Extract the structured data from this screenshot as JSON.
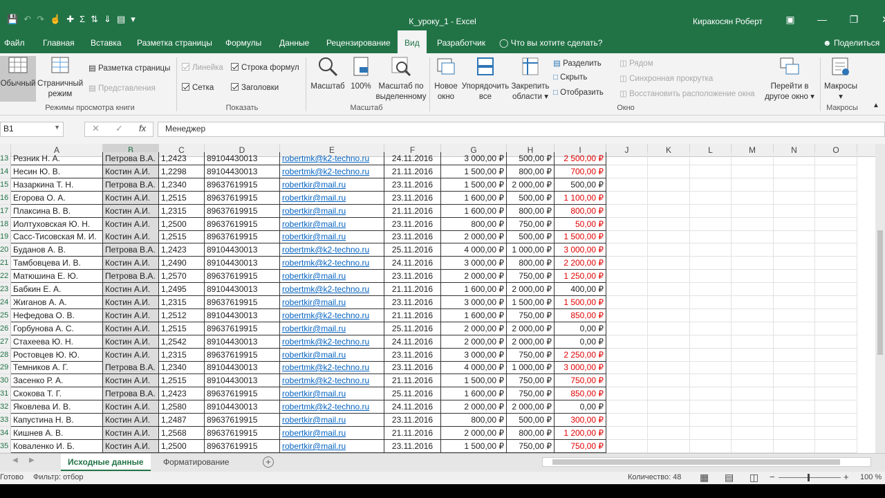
{
  "window": {
    "title": "К_уроку_1  -  Excel",
    "user": "Киракосян Роберт"
  },
  "ribbon_tabs": [
    "Файл",
    "Главная",
    "Вставка",
    "Разметка страницы",
    "Формулы",
    "Данные",
    "Рецензирование",
    "Вид",
    "Разработчик"
  ],
  "active_tab": "Вид",
  "tell_me": "Что вы хотите сделать?",
  "share": "Поделиться",
  "ribbon": {
    "views": {
      "normal": "Обычный",
      "page_break_1": "Страничный",
      "page_break_2": "режим",
      "page_layout": "Разметка страницы",
      "custom_views": "Представления",
      "group": "Режимы просмотра книги"
    },
    "show": {
      "ruler": "Линейка",
      "formula_bar": "Строка формул",
      "gridlines": "Сетка",
      "headings": "Заголовки",
      "group": "Показать"
    },
    "zoom": {
      "zoom": "Масштаб",
      "hundred": "100%",
      "zoom_sel_1": "Масштаб по",
      "zoom_sel_2": "выделенному",
      "group": "Масштаб"
    },
    "window": {
      "new_1": "Новое",
      "new_2": "окно",
      "arrange_1": "Упорядочить",
      "arrange_2": "все",
      "freeze_1": "Закрепить",
      "freeze_2": "области",
      "split": "Разделить",
      "hide": "Скрыть",
      "unhide": "Отобразить",
      "side_by_side": "Рядом",
      "sync_scroll": "Синхронная прокрутка",
      "reset_pos": "Восстановить расположение окна",
      "switch_1": "Перейти в",
      "switch_2": "другое окно",
      "group": "Окно"
    },
    "macros": {
      "macros": "Макросы",
      "group": "Макросы"
    }
  },
  "formula_bar": {
    "name_box": "B1",
    "content": "Менеджер"
  },
  "columns": [
    "A",
    "B",
    "C",
    "D",
    "E",
    "F",
    "G",
    "H",
    "I",
    "J",
    "K",
    "L",
    "M",
    "N",
    "O"
  ],
  "rows": [
    [
      "13",
      "Резник Н. А.",
      "Петрова В.А.",
      "1,2423",
      "89104430013",
      "robertmk@k2-techno.ru",
      "24.11.2016",
      "3 000,00 ₽",
      "500,00 ₽",
      "2 500,00 ₽"
    ],
    [
      "14",
      "Несин Ю. В.",
      "Костин А.И.",
      "1,2298",
      "89104430013",
      "robertmk@k2-techno.ru",
      "21.11.2016",
      "1 500,00 ₽",
      "800,00 ₽",
      "700,00 ₽"
    ],
    [
      "15",
      "Назаркина Т. Н.",
      "Петрова В.А.",
      "1,2340",
      "89637619915",
      "robertkir@mail.ru",
      "23.11.2016",
      "1 500,00 ₽",
      "2 000,00 ₽",
      "500,00 ₽"
    ],
    [
      "16",
      "Егорова О. А.",
      "Костин А.И.",
      "1,2515",
      "89637619915",
      "robertkir@mail.ru",
      "23.11.2016",
      "1 600,00 ₽",
      "500,00 ₽",
      "1 100,00 ₽"
    ],
    [
      "17",
      "Плаксина В. В.",
      "Костин А.И.",
      "1,2315",
      "89637619915",
      "robertkir@mail.ru",
      "21.11.2016",
      "1 600,00 ₽",
      "800,00 ₽",
      "800,00 ₽"
    ],
    [
      "18",
      "Иолтуховская Ю. Н.",
      "Костин А.И.",
      "1,2500",
      "89637619915",
      "robertkir@mail.ru",
      "23.11.2016",
      "800,00 ₽",
      "750,00 ₽",
      "50,00 ₽"
    ],
    [
      "19",
      "Сасс-Тисовская М. И.",
      "Костин А.И.",
      "1,2515",
      "89637619915",
      "robertkir@mail.ru",
      "23.11.2016",
      "2 000,00 ₽",
      "500,00 ₽",
      "1 500,00 ₽"
    ],
    [
      "20",
      "Буданов А. В.",
      "Петрова В.А.",
      "1,2423",
      "89104430013",
      "robertmk@k2-techno.ru",
      "25.11.2016",
      "4 000,00 ₽",
      "1 000,00 ₽",
      "3 000,00 ₽"
    ],
    [
      "21",
      "Тамбовцева И. В.",
      "Костин А.И.",
      "1,2490",
      "89104430013",
      "robertmk@k2-techno.ru",
      "24.11.2016",
      "3 000,00 ₽",
      "800,00 ₽",
      "2 200,00 ₽"
    ],
    [
      "22",
      "Матюшина Е. Ю.",
      "Петрова В.А.",
      "1,2570",
      "89637619915",
      "robertkir@mail.ru",
      "23.11.2016",
      "2 000,00 ₽",
      "750,00 ₽",
      "1 250,00 ₽"
    ],
    [
      "23",
      "Бабкин Е. А.",
      "Костин А.И.",
      "1,2495",
      "89104430013",
      "robertmk@k2-techno.ru",
      "21.11.2016",
      "1 600,00 ₽",
      "2 000,00 ₽",
      "400,00 ₽"
    ],
    [
      "24",
      "Жиганов А. А.",
      "Костин А.И.",
      "1,2315",
      "89637619915",
      "robertkir@mail.ru",
      "23.11.2016",
      "3 000,00 ₽",
      "1 500,00 ₽",
      "1 500,00 ₽"
    ],
    [
      "25",
      "Нефедова О. В.",
      "Костин А.И.",
      "1,2512",
      "89104430013",
      "robertmk@k2-techno.ru",
      "21.11.2016",
      "1 600,00 ₽",
      "750,00 ₽",
      "850,00 ₽"
    ],
    [
      "26",
      "Горбунова А. С.",
      "Костин А.И.",
      "1,2515",
      "89637619915",
      "robertkir@mail.ru",
      "25.11.2016",
      "2 000,00 ₽",
      "2 000,00 ₽",
      "0,00 ₽"
    ],
    [
      "27",
      "Стахеева Ю. Н.",
      "Костин А.И.",
      "1,2542",
      "89104430013",
      "robertmk@k2-techno.ru",
      "24.11.2016",
      "2 000,00 ₽",
      "2 000,00 ₽",
      "0,00 ₽"
    ],
    [
      "28",
      "Ростовцев Ю. Ю.",
      "Костин А.И.",
      "1,2315",
      "89637619915",
      "robertkir@mail.ru",
      "23.11.2016",
      "3 000,00 ₽",
      "750,00 ₽",
      "2 250,00 ₽"
    ],
    [
      "29",
      "Темников А. Г.",
      "Петрова В.А.",
      "1,2340",
      "89104430013",
      "robertmk@k2-techno.ru",
      "23.11.2016",
      "4 000,00 ₽",
      "1 000,00 ₽",
      "3 000,00 ₽"
    ],
    [
      "30",
      "Засенко Р. А.",
      "Костин А.И.",
      "1,2515",
      "89104430013",
      "robertmk@k2-techno.ru",
      "21.11.2016",
      "1 500,00 ₽",
      "750,00 ₽",
      "750,00 ₽"
    ],
    [
      "31",
      "Скокова Т. Г.",
      "Петрова В.А.",
      "1,2423",
      "89637619915",
      "robertkir@mail.ru",
      "25.11.2016",
      "1 600,00 ₽",
      "750,00 ₽",
      "850,00 ₽"
    ],
    [
      "32",
      "Яковлева И. В.",
      "Костин А.И.",
      "1,2580",
      "89104430013",
      "robertmk@k2-techno.ru",
      "24.11.2016",
      "2 000,00 ₽",
      "2 000,00 ₽",
      "0,00 ₽"
    ],
    [
      "33",
      "Капустина Н. В.",
      "Костин А.И.",
      "1,2487",
      "89637619915",
      "robertkir@mail.ru",
      "23.11.2016",
      "800,00 ₽",
      "500,00 ₽",
      "300,00 ₽"
    ],
    [
      "34",
      "Кишнев А. В.",
      "Костин А.И.",
      "1,2568",
      "89637619915",
      "robertkir@mail.ru",
      "21.11.2016",
      "2 000,00 ₽",
      "800,00 ₽",
      "1 200,00 ₽"
    ],
    [
      "35",
      "Коваленко И. Б.",
      "Костин А.И.",
      "1,2500",
      "89637619915",
      "robertkir@mail.ru",
      "23.11.2016",
      "1 500,00 ₽",
      "750,00 ₽",
      "750,00 ₽"
    ]
  ],
  "sheets": [
    "Исходные данные",
    "Форматирование"
  ],
  "active_sheet": "Исходные данные",
  "status": {
    "ready": "Готово",
    "filter": "Фильтр: отбор",
    "count": "Количество: 48",
    "zoom": "100 %"
  },
  "colors": {
    "excel_green": "#217346",
    "negative_red": "#e00000",
    "hyperlink": "#0563c1"
  }
}
